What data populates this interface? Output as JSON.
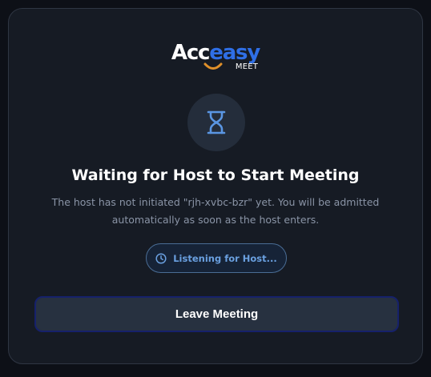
{
  "logo": {
    "word_part1": "Acc",
    "word_part2": "easy",
    "sub": "MEET"
  },
  "waiting": {
    "icon": "hourglass-icon",
    "title": "Waiting for Host to Start Meeting",
    "description": "The host has not initiated \"rjh-xvbc-bzr\" yet. You will be admitted automatically as soon as the host enters.",
    "status_icon": "clock-icon",
    "status_label": "Listening for Host..."
  },
  "actions": {
    "leave_label": "Leave Meeting"
  },
  "colors": {
    "background": "#0d1017",
    "card": "#161b24",
    "accent": "#2f6fe6",
    "status_text": "#6aa0e0",
    "button": "#273140"
  }
}
